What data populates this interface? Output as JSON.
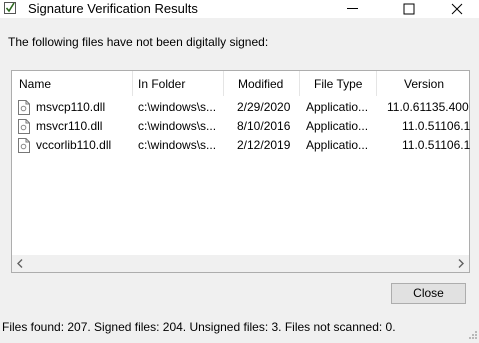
{
  "window": {
    "title": "Signature Verification Results",
    "controls": [
      "minimize-icon",
      "maximize-icon",
      "close-icon"
    ]
  },
  "message": "The following files have not been digitally signed:",
  "table": {
    "columns": [
      "Name",
      "In Folder",
      "Modified",
      "File Type",
      "Version"
    ],
    "rows": [
      {
        "name": "msvcp110.dll",
        "folder": "c:\\windows\\s...",
        "modified": "2/29/2020",
        "type": "Applicatio...",
        "version": "11.0.61135.400"
      },
      {
        "name": "msvcr110.dll",
        "folder": "c:\\windows\\s...",
        "modified": "8/10/2016",
        "type": "Applicatio...",
        "version": "11.0.51106.1"
      },
      {
        "name": "vccorlib110.dll",
        "folder": "c:\\windows\\s...",
        "modified": "2/12/2019",
        "type": "Applicatio...",
        "version": "11.0.51106.1"
      }
    ],
    "row_icon": "dll-file-icon"
  },
  "buttons": {
    "close_label": "Close"
  },
  "status": "Files found: 207.  Signed files: 204.  Unsigned files: 3.  Files not scanned: 0."
}
